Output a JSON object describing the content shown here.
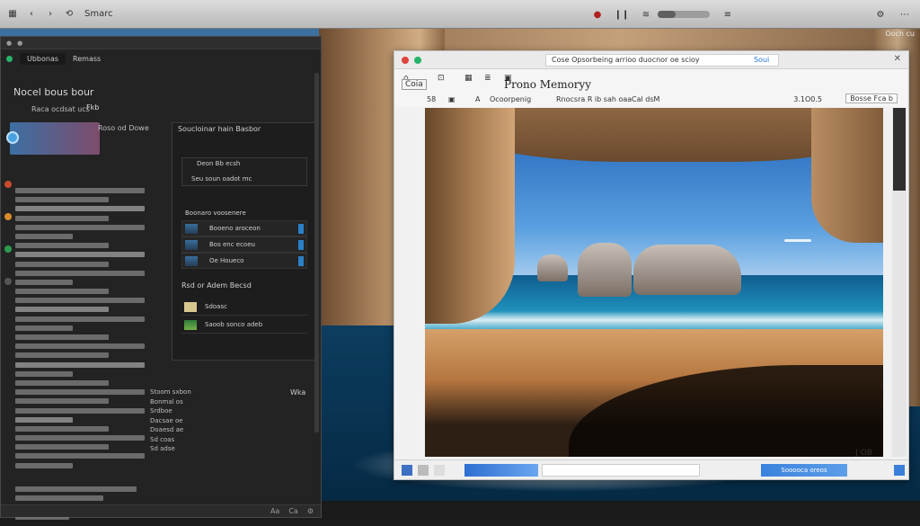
{
  "topbar": {
    "app_label": "Smarc",
    "search_label": "Ooch cu"
  },
  "code_window": {
    "tab_active": "Ubbonas",
    "tab_second": "Remass",
    "heading": "Nocel bous bour",
    "subheading": "Raca ocdsat ucs",
    "badge": "Fkb",
    "select_label": "Roso od Dowe",
    "panel": {
      "title": "Soucloinar hain Basbor",
      "card_line1": "Deon Bb ecsh",
      "card_line2": "Seu soun oadot mc",
      "section_title": "Boonaro voosenere",
      "rows": [
        "Booeno aroceon",
        "Bos enc ecoeu",
        "Oe Houeco"
      ],
      "title2": "Rsd or Adem Becsd",
      "rows2": [
        "Sdoasc",
        "Saoob sonco adeb"
      ]
    },
    "lower_block": [
      "Stoom sxbon",
      "Bonmal os",
      "Srdboe",
      "Dacsae oe",
      "Doaesd ae",
      "",
      "Sd coas",
      "Sd adse"
    ],
    "wka": "Wka",
    "status": [
      "Aa",
      "Ca"
    ]
  },
  "photo_window": {
    "title_field": "Cose Opsorbeing arrioo duocnor oe scioy",
    "share": "Soui",
    "app_name": "Prono Memoryy",
    "toolbar_left": "Coia",
    "subbar": [
      "Ocoorpenig",
      "Rnocsra R ib sah oaa",
      "Cal dsM"
    ],
    "zoom": "3.1O0.5",
    "right_button": "Bosse Fca b",
    "counter": "J OB",
    "action_button": "Sooooca oreos"
  },
  "colors": {
    "accent_blue": "#1f73d8",
    "active_green": "#28b36a",
    "code_bg": "#232323"
  }
}
